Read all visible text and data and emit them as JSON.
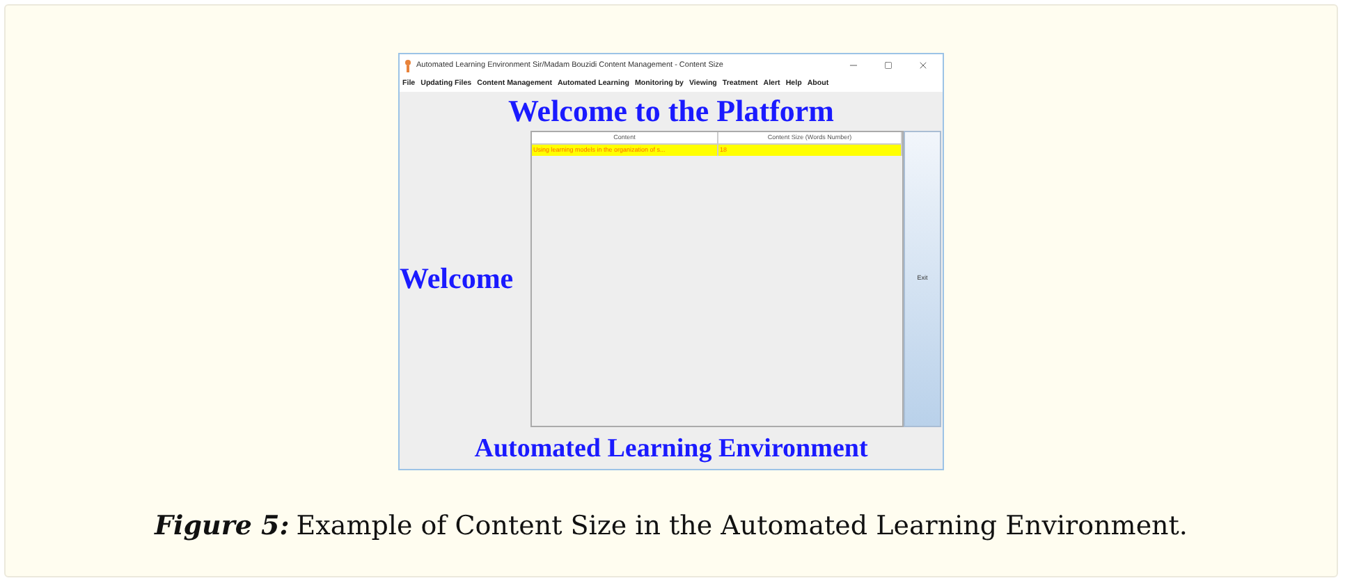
{
  "window": {
    "title": "Automated Learning Environment  Sir/Madam  Bouzidi  Content Management - Content Size"
  },
  "menu": [
    "File",
    "Updating Files",
    "Content Management",
    "Automated Learning",
    "Monitoring by",
    "Viewing",
    "Treatment",
    "Alert",
    "Help",
    "About"
  ],
  "heading": "Welcome to the Platform",
  "side_label": "Welcome",
  "table": {
    "columns": [
      "Content",
      "Content Size (Words Number)"
    ],
    "rows": [
      {
        "cells": [
          "Using learning models in the organization of s...",
          "18"
        ],
        "selected": true
      }
    ]
  },
  "exit_button": "Exit",
  "footer": "Automated Learning Environment",
  "caption": {
    "label": "Figure 5:",
    "text": "Example of Content Size in the Automated Learning Environment."
  }
}
